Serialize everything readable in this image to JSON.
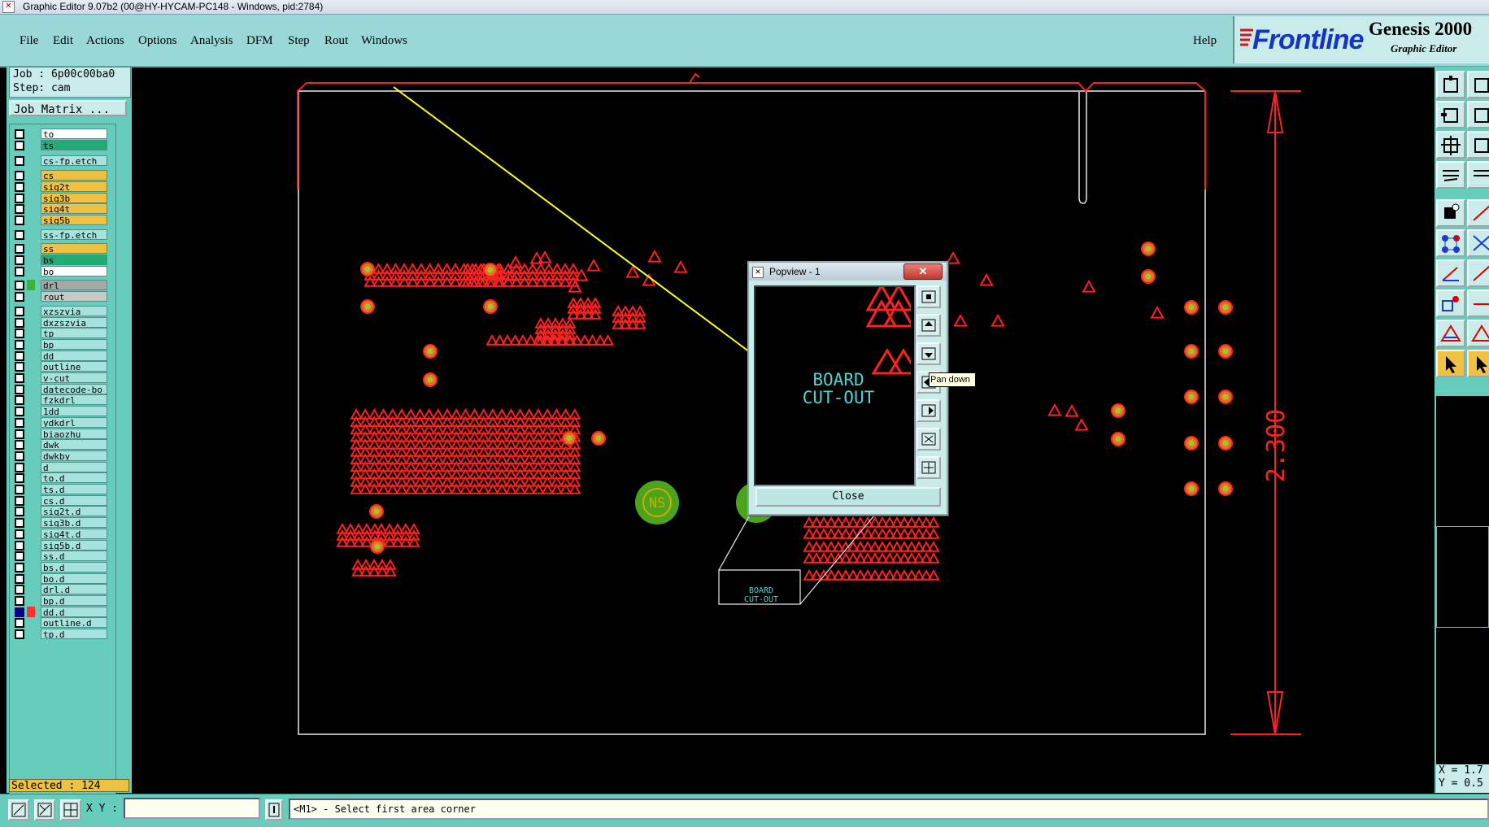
{
  "window": {
    "title": "Graphic Editor 9.07b2 (00@HY-HYCAM-PC148 - Windows, pid:2784)"
  },
  "menu": {
    "items": [
      "File",
      "Edit",
      "Actions",
      "Options",
      "Analysis",
      "DFM",
      "Step",
      "Rout",
      "Windows"
    ],
    "help": "Help"
  },
  "logo": {
    "brand": "Frontline",
    "product": "Genesis 2000",
    "subtitle": "Graphic Editor"
  },
  "job": {
    "job_line": "Job : 6p00c00ba0",
    "step_line": "Step: cam",
    "matrix_button": "Job Matrix ..."
  },
  "layers": [
    {
      "name": "to",
      "color": "#ffffff"
    },
    {
      "name": "ts",
      "color": "#22aa77"
    },
    {
      "name": "cs-fp.etch",
      "color": "#a6e3dd"
    },
    {
      "name": "cs",
      "color": "#f0c040"
    },
    {
      "name": "sig2t",
      "color": "#f0c040"
    },
    {
      "name": "sig3b",
      "color": "#f0c040"
    },
    {
      "name": "sig4t",
      "color": "#f0c040"
    },
    {
      "name": "sig5b",
      "color": "#f0c040"
    },
    {
      "name": "ss-fp.etch",
      "color": "#a6e3dd"
    },
    {
      "name": "ss",
      "color": "#f0c040"
    },
    {
      "name": "bs",
      "color": "#22aa77"
    },
    {
      "name": "bo",
      "color": "#ffffff"
    },
    {
      "name": "drl",
      "color": "#a7a7a7"
    },
    {
      "name": "rout",
      "color": "#c8c8c8"
    },
    {
      "name": "xzszvia",
      "color": "#a6e3dd"
    },
    {
      "name": "dxzszvia",
      "color": "#a6e3dd"
    },
    {
      "name": "tp",
      "color": "#a6e3dd"
    },
    {
      "name": "bp",
      "color": "#a6e3dd"
    },
    {
      "name": "dd",
      "color": "#a6e3dd"
    },
    {
      "name": "outline",
      "color": "#a6e3dd"
    },
    {
      "name": "v-cut",
      "color": "#a6e3dd"
    },
    {
      "name": "datecode-bo",
      "color": "#a6e3dd"
    },
    {
      "name": "fzkdrl",
      "color": "#a6e3dd"
    },
    {
      "name": "1dd",
      "color": "#a6e3dd"
    },
    {
      "name": "ydkdrl",
      "color": "#a6e3dd"
    },
    {
      "name": "biaozhu",
      "color": "#a6e3dd"
    },
    {
      "name": "dwk",
      "color": "#a6e3dd"
    },
    {
      "name": "dwkby",
      "color": "#a6e3dd"
    },
    {
      "name": "d",
      "color": "#a6e3dd"
    },
    {
      "name": "to.d",
      "color": "#a6e3dd"
    },
    {
      "name": "ts.d",
      "color": "#a6e3dd"
    },
    {
      "name": "cs.d",
      "color": "#a6e3dd"
    },
    {
      "name": "sig2t.d",
      "color": "#a6e3dd"
    },
    {
      "name": "sig3b.d",
      "color": "#a6e3dd"
    },
    {
      "name": "sig4t.d",
      "color": "#a6e3dd"
    },
    {
      "name": "sig5b.d",
      "color": "#a6e3dd"
    },
    {
      "name": "ss.d",
      "color": "#a6e3dd"
    },
    {
      "name": "bs.d",
      "color": "#a6e3dd"
    },
    {
      "name": "bo.d",
      "color": "#a6e3dd"
    },
    {
      "name": "drl.d",
      "color": "#a6e3dd"
    },
    {
      "name": "bp.d",
      "color": "#a6e3dd"
    },
    {
      "name": "dd.d",
      "color": "#a6e3dd",
      "work": true
    },
    {
      "name": "outline.d",
      "color": "#a6e3dd"
    },
    {
      "name": "tp.d",
      "color": "#a6e3dd"
    }
  ],
  "selected_count": "Selected : 124",
  "canvas": {
    "dimension_label": "2.300",
    "board_text_line1": "BOARD",
    "board_text_line2": "CUT-OUT",
    "via_label": "NS"
  },
  "popview": {
    "title": "Popview - 1",
    "close_button": "Close",
    "tooltip": "Pan down"
  },
  "coords": {
    "x": "X = 1.7",
    "y": "Y = 0.5"
  },
  "status": {
    "xy_label": "X Y :",
    "xy_value": "",
    "message": "<M1> - Select first area corner"
  }
}
